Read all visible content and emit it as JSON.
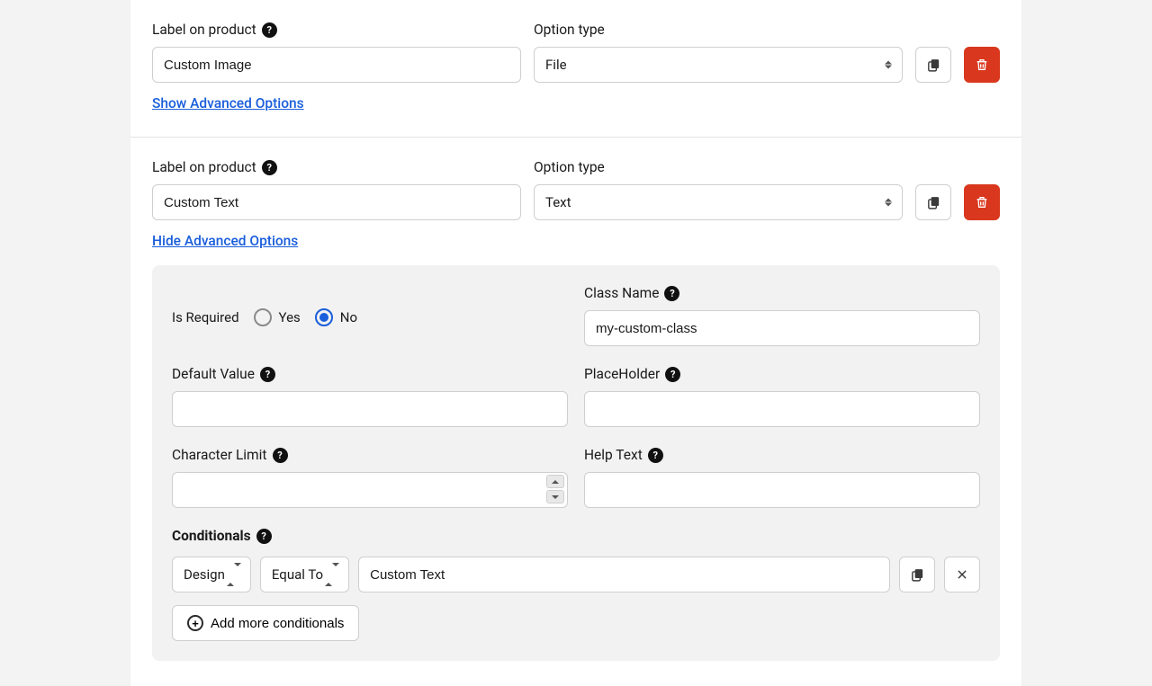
{
  "labels": {
    "label_on_product": "Label on product",
    "option_type": "Option type",
    "show_advanced": "Show Advanced Options",
    "hide_advanced": "Hide Advanced Options",
    "is_required": "Is Required",
    "yes": "Yes",
    "no": "No",
    "class_name": "Class Name",
    "default_value": "Default Value",
    "placeholder": "PlaceHolder",
    "character_limit": "Character Limit",
    "help_text": "Help Text",
    "conditionals": "Conditionals",
    "add_more_conditionals": "Add more conditionals"
  },
  "option1": {
    "label_value": "Custom Image",
    "type_value": "File"
  },
  "option2": {
    "label_value": "Custom Text",
    "type_value": "Text",
    "advanced": {
      "is_required": "No",
      "class_name_value": "my-custom-class",
      "default_value": "",
      "placeholder_value": "",
      "character_limit_value": "",
      "help_text_value": "",
      "conditional": {
        "field": "Design",
        "operator": "Equal To",
        "value": "Custom Text"
      }
    }
  }
}
